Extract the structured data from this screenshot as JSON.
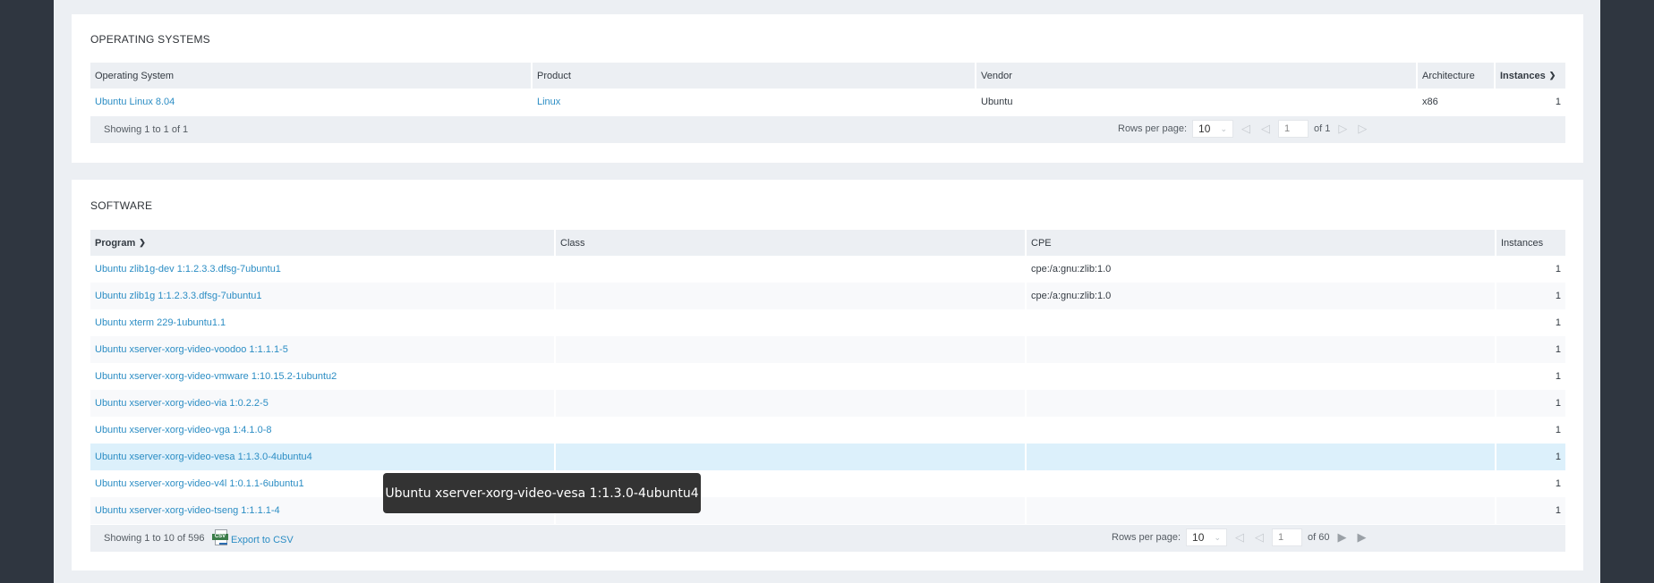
{
  "operating_systems": {
    "title": "OPERATING SYSTEMS",
    "columns": [
      {
        "label": "Operating System",
        "sorted": false
      },
      {
        "label": "Product",
        "sorted": false
      },
      {
        "label": "Vendor",
        "sorted": false
      },
      {
        "label": "Architecture",
        "sorted": false
      },
      {
        "label": "Instances",
        "sorted": true,
        "sort_icon": "chevron-down-icon"
      }
    ],
    "rows": [
      {
        "os": "Ubuntu Linux 8.04",
        "product": "Linux",
        "vendor": "Ubuntu",
        "architecture": "x86",
        "instances": "1"
      }
    ],
    "footer": {
      "showing": "Showing 1 to 1 of 1",
      "rows_per_page_label": "Rows per page:",
      "rows_per_page_value": "10",
      "page_value": "1",
      "of_pages": "of 1"
    }
  },
  "software": {
    "title": "SOFTWARE",
    "columns": [
      {
        "label": "Program",
        "sorted": true,
        "sort_icon": "chevron-down-icon"
      },
      {
        "label": "Class",
        "sorted": false
      },
      {
        "label": "CPE",
        "sorted": false
      },
      {
        "label": "Instances",
        "sorted": false
      }
    ],
    "rows": [
      {
        "program": "Ubuntu zlib1g-dev 1:1.2.3.3.dfsg-7ubuntu1",
        "class": "",
        "cpe": "cpe:/a:gnu:zlib:1.0",
        "instances": "1"
      },
      {
        "program": "Ubuntu zlib1g 1:1.2.3.3.dfsg-7ubuntu1",
        "class": "",
        "cpe": "cpe:/a:gnu:zlib:1.0",
        "instances": "1"
      },
      {
        "program": "Ubuntu xterm 229-1ubuntu1.1",
        "class": "",
        "cpe": "",
        "instances": "1"
      },
      {
        "program": "Ubuntu xserver-xorg-video-voodoo 1:1.1.1-5",
        "class": "",
        "cpe": "",
        "instances": "1"
      },
      {
        "program": "Ubuntu xserver-xorg-video-vmware 1:10.15.2-1ubuntu2",
        "class": "",
        "cpe": "",
        "instances": "1"
      },
      {
        "program": "Ubuntu xserver-xorg-video-via 1:0.2.2-5",
        "class": "",
        "cpe": "",
        "instances": "1"
      },
      {
        "program": "Ubuntu xserver-xorg-video-vga 1:4.1.0-8",
        "class": "",
        "cpe": "",
        "instances": "1"
      },
      {
        "program": "Ubuntu xserver-xorg-video-vesa 1:1.3.0-4ubuntu4",
        "class": "",
        "cpe": "",
        "instances": "1",
        "hovered": true
      },
      {
        "program": "Ubuntu xserver-xorg-video-v4l 1:0.1.1-6ubuntu1",
        "class": "",
        "cpe": "",
        "instances": "1"
      },
      {
        "program": "Ubuntu xserver-xorg-video-tseng 1:1.1.1-4",
        "class": "",
        "cpe": "",
        "instances": "1"
      }
    ],
    "footer": {
      "showing": "Showing 1 to 10 of 596",
      "export_label": "Export to CSV",
      "export_icon_text": "CSV",
      "rows_per_page_label": "Rows per page:",
      "rows_per_page_value": "10",
      "page_value": "1",
      "of_pages": "of 60"
    }
  },
  "tooltip": {
    "text": "Ubuntu xserver-xorg-video-vesa 1:1.3.0-4ubuntu4"
  },
  "colors": {
    "link": "#2b8dc4",
    "header_bg": "#eceff3",
    "hover_row": "#dcf0fb",
    "rail": "#2f3640",
    "tooltip_bg": "#333333"
  }
}
